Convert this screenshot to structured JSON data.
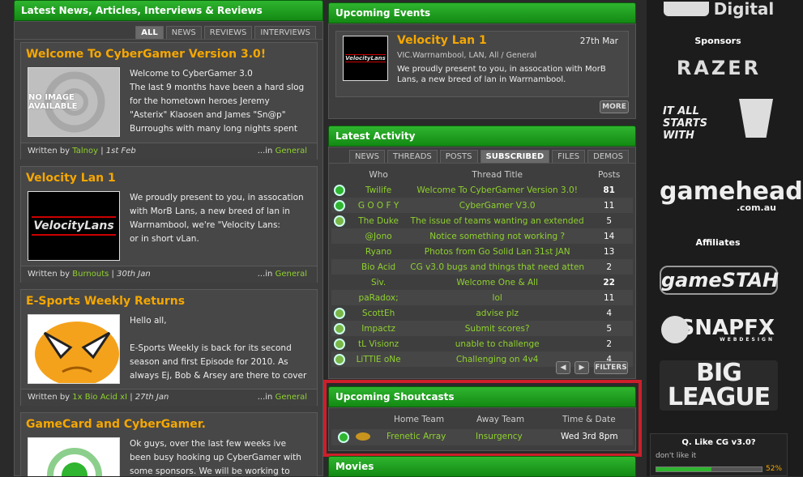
{
  "news": {
    "header": "Latest News, Articles, Interviews & Reviews",
    "tabs": [
      "ALL",
      "NEWS",
      "REVIEWS",
      "INTERVIEWS"
    ],
    "articles": [
      {
        "title": "Welcome To CyberGamer Version 3.0!",
        "thumb": "NO IMAGE AVAILABLE",
        "body": "Welcome to CyberGamer 3.0\nThe last 9 months have been a hard slog for the hometown heroes Jeremy \"Asterix\" Klaosen and James \"Sn@p\" Burroughs with many long nights spent with heads buried in",
        "by_label": "Written by",
        "author": "Talnoy",
        "date": "1st Feb",
        "in_label": "...in",
        "category": "General"
      },
      {
        "title": "Velocity Lan 1",
        "thumb": "VelocityLans",
        "body": "We proudly present to you, in assocation with MorB Lans, a new breed of lan in Warrnambool, we're \"Velocity Lans:\nor in short vLan.",
        "by_label": "Written by",
        "author": "Burnouts",
        "date": "30th Jan",
        "in_label": "...in",
        "category": "General"
      },
      {
        "title": "E-Sports Weekly Returns",
        "thumb": "",
        "body": "Hello all,\n\nE-Sports Weekly is back for its second season and first Episode for 2010. As always Ej, Bob & Arsey are there to cover all things",
        "by_label": "Written by",
        "author": "1x Bio Acid xI",
        "date": "27th Jan",
        "in_label": "...in",
        "category": "General"
      },
      {
        "title": "GameCard and CyberGamer.",
        "thumb": "",
        "body": "Ok guys, over the last few weeks ive been busy hooking up CyberGamer with some sponsors. We will be working to make our"
      }
    ]
  },
  "events": {
    "header": "Upcoming Events",
    "title": "Velocity Lan 1",
    "date": "27th Mar",
    "meta": "VIC.Warrnambool, LAN, All / General",
    "desc": "We proudly present to you, in assocation with MorB Lans, a new breed of lan in Warrnambool.",
    "thumb": "VelocityLans",
    "more": "MORE"
  },
  "activity": {
    "header": "Latest Activity",
    "tabs": [
      "NEWS",
      "THREADS",
      "POSTS",
      "SUBSCRIBED",
      "FILES",
      "DEMOS"
    ],
    "cols": [
      "Who",
      "Thread Title",
      "Posts"
    ],
    "rows": [
      {
        "who": "Twilife",
        "title": "Welcome To CyberGamer Version 3.0!",
        "posts": "81",
        "bold": true,
        "icon": "g"
      },
      {
        "who": "G O O F Y",
        "title": "CyberGamer V3.0",
        "posts": "11",
        "icon": "g"
      },
      {
        "who": "The Duke",
        "title": "The issue of teams wanting an extended",
        "posts": "5",
        "icon": "z",
        "arrow": true
      },
      {
        "who": "@Jono",
        "title": "Notice something not working ?",
        "posts": "14"
      },
      {
        "who": "Ryano",
        "title": "Photos from Go Solid Lan 31st JAN",
        "posts": "13"
      },
      {
        "who": "Bio Acid",
        "title": "CG v3.0 bugs and things that need atten",
        "posts": "2",
        "arrow": true
      },
      {
        "who": "Siv.",
        "title": "Welcome One & All",
        "posts": "22",
        "bold": true
      },
      {
        "who": "paRadox;",
        "title": "lol",
        "posts": "11"
      },
      {
        "who": "ScottEh",
        "title": "advise plz",
        "posts": "4",
        "icon": "z"
      },
      {
        "who": "Impactz",
        "title": "Submit scores?",
        "posts": "5",
        "icon": "z"
      },
      {
        "who": "tL Visionz",
        "title": "unable to challenge",
        "posts": "2",
        "icon": "z"
      },
      {
        "who": "LiTTlE oNe",
        "title": "Challenging on 4v4",
        "posts": "4",
        "icon": "z"
      }
    ],
    "filters": "FILTERS"
  },
  "shoutcasts": {
    "header": "Upcoming Shoutcasts",
    "cols": [
      "Home Team",
      "Away Team",
      "Time & Date"
    ],
    "home": "Frenetic Array",
    "away": "Insurgency",
    "time": "Wed 3rd 8pm"
  },
  "movies": {
    "header": "Movies"
  },
  "sidebar": {
    "wd": "Digital",
    "sponsors_label": "Sponsors",
    "sponsors": [
      "RAZER",
      "IT ALL STARTS WITH",
      "gamehead",
      ".com.au"
    ],
    "affiliates_label": "Affiliates",
    "affiliates": [
      "gameSTAH",
      "SNAPFX",
      "WEBDESIGN",
      "BIG LEAGUE"
    ],
    "poll": {
      "question": "Q. Like CG v3.0?",
      "option": "don't like it",
      "percent": "52%",
      "fill": 0.52
    }
  },
  "colors": {
    "accent": "#1aa01a",
    "title": "#f5a700",
    "link": "#8fd12e",
    "highlight": "#cc1f2b"
  }
}
